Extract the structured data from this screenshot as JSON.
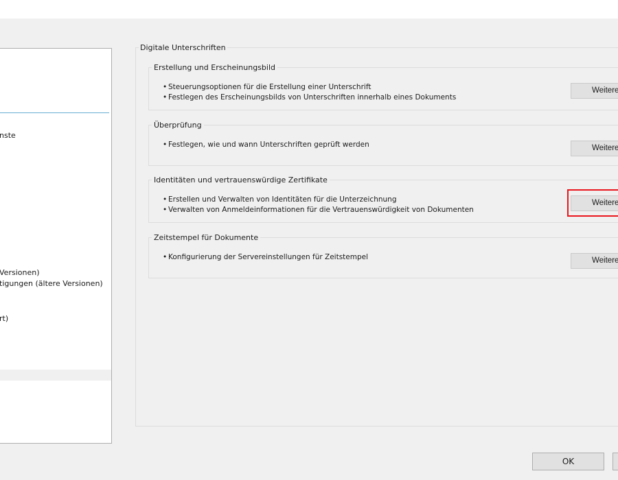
{
  "left_list": {
    "items": [
      "nste",
      "Versionen)",
      "tigungen (ältere Versionen)",
      "rt)"
    ]
  },
  "section": {
    "title": "Digitale Unterschriften",
    "more_label": "Weitere..",
    "groups": [
      {
        "title": "Erstellung und Erscheinungsbild",
        "bullets": [
          "Steuerungsoptionen für die Erstellung einer Unterschrift",
          "Festlegen des Erscheinungsbilds von Unterschriften innerhalb eines Dokuments"
        ]
      },
      {
        "title": "Überprüfung",
        "bullets": [
          "Festlegen, wie und wann Unterschriften geprüft werden"
        ]
      },
      {
        "title": "Identitäten und vertrauenswürdige Zertifikate",
        "bullets": [
          "Erstellen und Verwalten von Identitäten für die Unterzeichnung",
          "Verwalten von Anmeldeinformationen für die Vertrauenswürdigkeit von Dokumenten"
        ]
      },
      {
        "title": "Zeitstempel für Dokumente",
        "bullets": [
          "Konfigurierung der Servereinstellungen für Zeitstempel"
        ]
      }
    ]
  },
  "footer": {
    "ok_label": "OK"
  },
  "highlight_color": "#e8151b"
}
